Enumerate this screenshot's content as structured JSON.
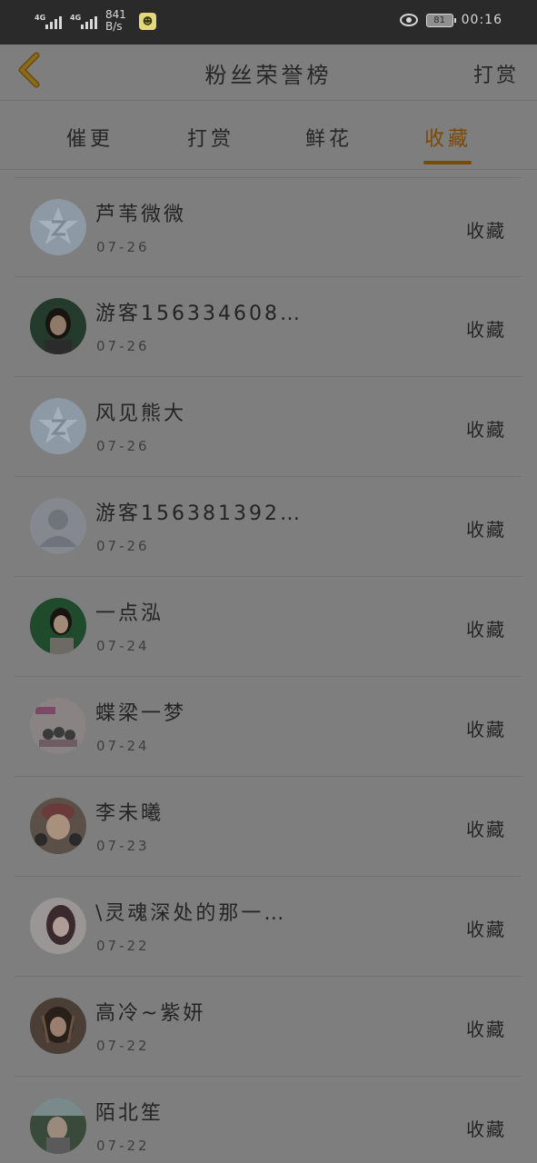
{
  "status_bar": {
    "sim1": "4G",
    "sim2": "4G",
    "speed_value": "841",
    "speed_unit": "B/s",
    "battery": "81",
    "time": "00:16"
  },
  "nav": {
    "title": "粉丝荣誉榜",
    "action": "打赏"
  },
  "tabs": [
    {
      "label": "催更"
    },
    {
      "label": "打赏"
    },
    {
      "label": "鲜花"
    },
    {
      "label": "收藏"
    }
  ],
  "active_tab": "收藏",
  "colors": {
    "accent": "#7a4a05",
    "background": "#7e7e7e",
    "status_bar": "#2a2a2a"
  },
  "list": [
    {
      "name": "芦苇微微",
      "date": "07-26",
      "action": "收藏",
      "avatar": "qq-default-icon"
    },
    {
      "name": "游客156334608…",
      "date": "07-26",
      "action": "收藏",
      "avatar": "user-photo"
    },
    {
      "name": "风见熊大",
      "date": "07-26",
      "action": "收藏",
      "avatar": "qq-default-icon"
    },
    {
      "name": "游客156381392…",
      "date": "07-26",
      "action": "收藏",
      "avatar": "person-placeholder-icon"
    },
    {
      "name": "一点泓",
      "date": "07-24",
      "action": "收藏",
      "avatar": "user-photo"
    },
    {
      "name": "蝶梁一梦",
      "date": "07-24",
      "action": "收藏",
      "avatar": "user-photo"
    },
    {
      "name": "李未曦",
      "date": "07-23",
      "action": "收藏",
      "avatar": "user-photo"
    },
    {
      "name": "\\灵魂深处的那一…",
      "date": "07-22",
      "action": "收藏",
      "avatar": "user-photo"
    },
    {
      "name": "高冷~紫妍",
      "date": "07-22",
      "action": "收藏",
      "avatar": "user-photo"
    },
    {
      "name": "陌北笙",
      "date": "07-22",
      "action": "收藏",
      "avatar": "user-photo"
    }
  ]
}
